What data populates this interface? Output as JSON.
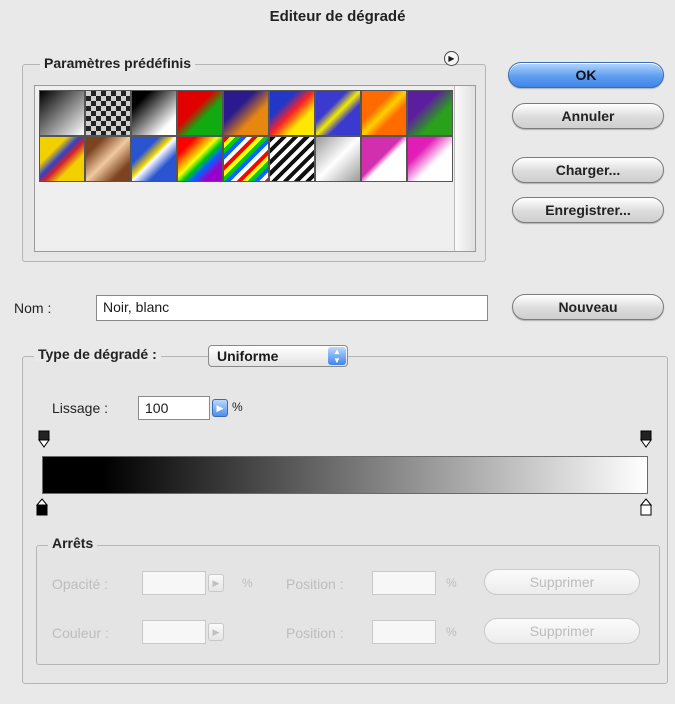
{
  "window": {
    "title": "Editeur de dégradé"
  },
  "presets": {
    "legend": "Paramètres prédéfinis",
    "menu_icon": "play-circle-icon",
    "swatches": [
      {
        "bg": "linear-gradient(135deg,#000 0%,#fff 100%)"
      },
      {
        "bg": "repeating-conic-gradient(#222 0 25%, #cfcfcf 0 50%) 0 0/10px 10px"
      },
      {
        "bg": "linear-gradient(135deg,#000 20%,#fff 80%)"
      },
      {
        "bg": "linear-gradient(135deg,#e00000 40%,#11aa11 60%)"
      },
      {
        "bg": "linear-gradient(135deg,#2b1a8e 35%,#e8870f 65%)"
      },
      {
        "bg": "linear-gradient(135deg,#2236c8 30%,#ff2222 50%,#ffe800 70%)"
      },
      {
        "bg": "linear-gradient(135deg,#3a3ad0 35%,#f3e900 50%,#3a3ad0 65%)"
      },
      {
        "bg": "linear-gradient(135deg,#ff6b00 35%,#ffd000 50%,#ff6b00 65%)"
      },
      {
        "bg": "linear-gradient(135deg,#5b1e9e 35%,#2aa11a 65%)"
      },
      {
        "bg": "linear-gradient(135deg,#f2d000 30%,#3241c7 45%,#d6212b 55%,#f2d000 70%)"
      },
      {
        "bg": "linear-gradient(135deg,#7b4320 20%,#f1c9a0 50%,#7b4320 80%)"
      },
      {
        "bg": "linear-gradient(135deg,#2a54d1 30%,#f4d000 45%,#ffffff 50%,#2a54d1 70%)"
      },
      {
        "bg": "linear-gradient(135deg,#ff0000 20%,#ff9900 35%,#ffff00 45%,#00cc00 55%,#0066ff 65%,#9900cc 80%)"
      },
      {
        "bg": "repeating-linear-gradient(135deg,#ff0000 0 4px,#ffff00 4px 8px,#00cc00 8px 12px,#0066ff 12px 16px,#ffffff 16px 20px)"
      },
      {
        "bg": "repeating-linear-gradient(135deg,#111 0 4px,#fff 4px 8px)"
      },
      {
        "bg": "linear-gradient(135deg,#9a9a9a 0%,#ffffff 50%,#9a9a9a 100%)"
      },
      {
        "bg": "linear-gradient(135deg,#d22fae 45%,#ffffff 55%)"
      },
      {
        "bg": "linear-gradient(135deg,#e21db6 30%,#ffffff 60%)"
      }
    ]
  },
  "buttons": {
    "ok": "OK",
    "cancel": "Annuler",
    "load": "Charger...",
    "save": "Enregistrer...",
    "new": "Nouveau"
  },
  "name": {
    "label": "Nom :",
    "value": "Noir, blanc"
  },
  "gradient": {
    "type_label": "Type de dégradé :",
    "type_value": "Uniforme",
    "smoothness_label": "Lissage :",
    "smoothness_value": "100",
    "smoothness_unit": "%",
    "colors": {
      "start": "#000000",
      "end": "#ffffff"
    }
  },
  "stops": {
    "legend": "Arrêts",
    "opacity_label": "Opacité :",
    "opacity_unit": "%",
    "opacity_position_label": "Position :",
    "opacity_position_unit": "%",
    "color_label": "Couleur :",
    "color_position_label": "Position :",
    "color_position_unit": "%",
    "delete_label": "Supprimer"
  }
}
